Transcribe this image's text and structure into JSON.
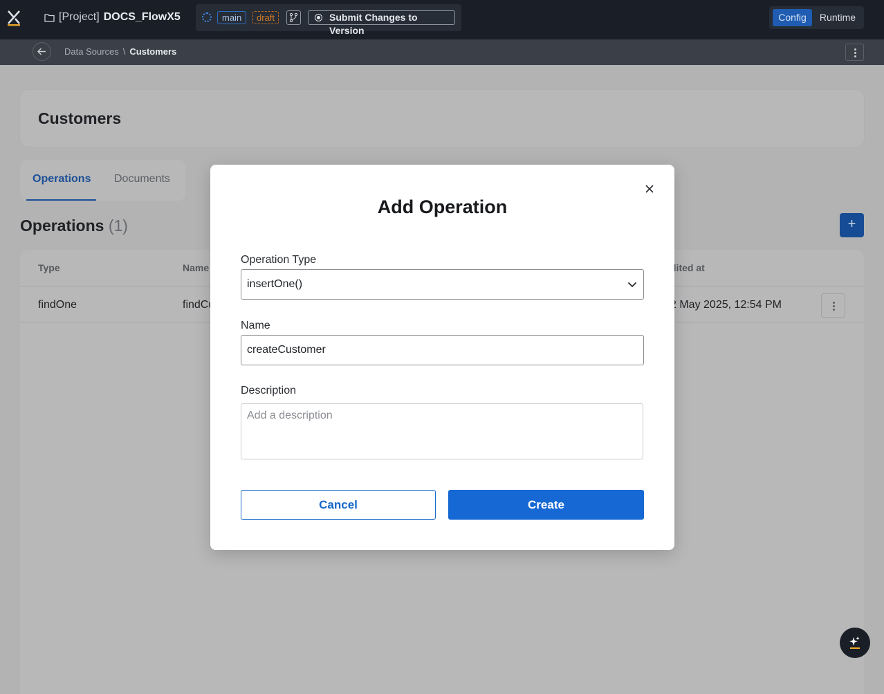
{
  "topbar": {
    "project_prefix": "[Project]",
    "project_name": "DOCS_FlowX5",
    "branch": "main",
    "state": "draft",
    "submit_label": "Submit Changes to Version",
    "mode_config": "Config",
    "mode_runtime": "Runtime"
  },
  "breadcrumb": {
    "parent": "Data Sources",
    "separator": "\\",
    "current": "Customers"
  },
  "page": {
    "title": "Customers",
    "tabs": [
      "Operations",
      "Documents"
    ],
    "active_tab": "Operations",
    "section_title": "Operations",
    "section_count": "(1)",
    "add_label": "+"
  },
  "table": {
    "headers": {
      "type": "Type",
      "name": "Name",
      "edited": "dited at"
    },
    "rows": [
      {
        "type": "findOne",
        "name": "findCu",
        "edited": "2 May 2025, 12:54 PM"
      }
    ]
  },
  "modal": {
    "title": "Add Operation",
    "operation_type_label": "Operation Type",
    "operation_type_value": "insertOne()",
    "name_label": "Name",
    "name_value": "createCustomer",
    "description_label": "Description",
    "description_placeholder": "Add a description",
    "cancel_label": "Cancel",
    "create_label": "Create"
  },
  "colors": {
    "primary": "#1668d4",
    "topbar_bg": "#1a1f27",
    "draft_orange": "#d07a2a"
  },
  "icons": [
    "flowx-logo-icon",
    "folder-icon",
    "spinner-icon",
    "git-branch-icon",
    "record-icon",
    "arrow-left-icon",
    "more-vertical-icon",
    "close-icon",
    "chevron-down-icon",
    "plus-icon",
    "ai-sparkle-icon"
  ]
}
